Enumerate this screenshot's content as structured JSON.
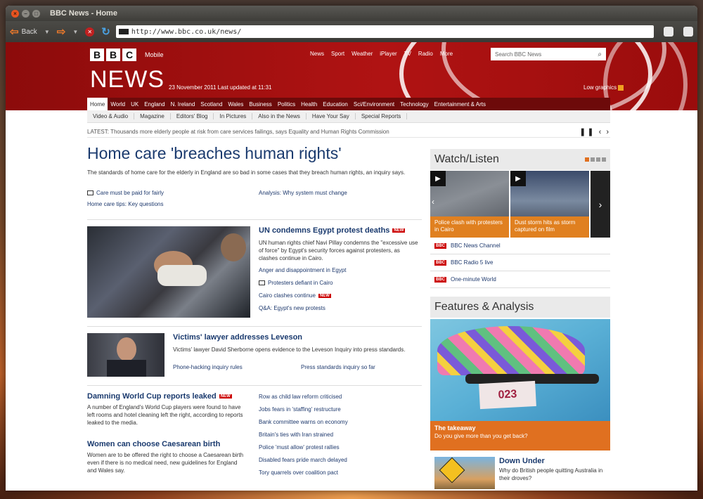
{
  "window": {
    "title": "BBC News - Home"
  },
  "browser": {
    "back_label": "Back",
    "url": "http://www.bbc.co.uk/news/"
  },
  "masthead": {
    "logo_letters": [
      "B",
      "B",
      "C"
    ],
    "logo_sub": "Mobile",
    "top_nav": [
      "News",
      "Sport",
      "Weather",
      "iPlayer",
      "TV",
      "Radio",
      "More"
    ],
    "search_placeholder": "Search BBC News",
    "title": "NEWS",
    "dateline": "23 November 2011   Last updated at 11:31",
    "low_graphics": "Low graphics"
  },
  "main_nav": [
    "Home",
    "World",
    "UK",
    "England",
    "N. Ireland",
    "Scotland",
    "Wales",
    "Business",
    "Politics",
    "Health",
    "Education",
    "Sci/Environment",
    "Technology",
    "Entertainment & Arts"
  ],
  "sub_nav": [
    "Video & Audio",
    "Magazine",
    "Editors' Blog",
    "In Pictures",
    "Also in the News",
    "Have Your Say",
    "Special Reports"
  ],
  "ticker": "LATEST: Thousands more elderly people at risk from care services failings, says Equality and Human Rights Commission",
  "lead": {
    "title": "Home care 'breaches human rights'",
    "summary": "The standards of home care for the elderly in England are so bad in some cases that they breach human rights, an inquiry says.",
    "link1": "Care must be paid for fairly",
    "link2": "Analysis: Why system must change",
    "link3": "Home care tips: Key questions"
  },
  "story2": {
    "title": "UN condemns Egypt protest deaths",
    "summary": "UN human rights chief Navi Pillay condemns the \"excessive use of force\" by Egypt's security forces against protesters, as clashes continue in Cairo.",
    "links": [
      "Anger and disappointment in Egypt",
      "Protesters defiant in Cairo",
      "Cairo clashes continue",
      "Q&A: Egypt's new protests"
    ]
  },
  "story3": {
    "title": "Victims' lawyer addresses Leveson",
    "summary": "Victims' lawyer David Sherborne opens evidence to the Leveson Inquiry into press standards.",
    "link1": "Phone-hacking inquiry rules",
    "link2": "Press standards inquiry so far"
  },
  "story4": {
    "title": "Damning World Cup reports leaked",
    "summary": "A number of England's World Cup players were found to have left rooms and hotel cleaning left the right, according to reports leaked to the media."
  },
  "story5": {
    "title": "Women can choose Caesarean birth",
    "summary": "Women are to be offered the right to choose a Caesarean birth even if there is no medical need, new guidelines for England and Wales say."
  },
  "list_links": [
    "Row as child law reform criticised",
    "Jobs fears in 'staffing' restructure",
    "Bank committee warns on economy",
    "Britain's ties with Iran strained",
    "Police 'must allow' protest rallies",
    "Disabled fears pride march delayed",
    "Tory quarrels over coalition pact"
  ],
  "watch": {
    "title": "Watch/Listen",
    "tile1": "Police clash with protesters in Cairo",
    "tile2": "Dust storm hits as storm captured on film",
    "rows": [
      "BBC News Channel",
      "BBC Radio 5 live",
      "One-minute World"
    ]
  },
  "features": {
    "title": "Features & Analysis",
    "strip_title": "The takeaway",
    "strip_text": "Do you give more than you get back?",
    "item_title": "Down Under",
    "item_text": "Why do British people quitting Australia in their droves?"
  }
}
